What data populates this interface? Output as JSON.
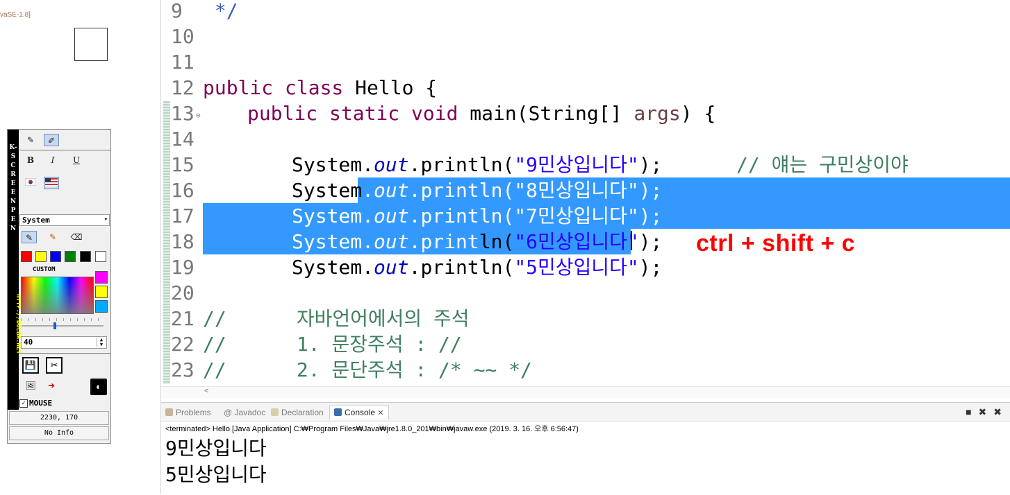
{
  "left_panel": {
    "jre_label": "vaSE-1.8]"
  },
  "kscreen_pen": {
    "vertical_title": "K-SCREEN PEN",
    "url": "HTTP://DOLBA.NET",
    "font_select": "System",
    "custom_label": "CUSTOM",
    "size_value": "40",
    "mouse_label": "MOUSE",
    "coords": "2230, 170",
    "info": "No Info",
    "palette": [
      "#ff0000",
      "#ffff00",
      "#0000ff",
      "#008000",
      "#000000",
      "#ffffff"
    ],
    "custom_swatches": [
      "#ff00ff",
      "#ffff00",
      "#00aaff"
    ]
  },
  "editor": {
    "lines": [
      {
        "no": "9",
        "text": " */"
      },
      {
        "no": "10",
        "text": ""
      },
      {
        "no": "11",
        "text": ""
      },
      {
        "no": "12",
        "kw": "public class",
        "rest": " Hello {"
      },
      {
        "no": "13",
        "kw": "public static void",
        "rest": " main(String[] ",
        "arg": "args",
        "tail": ") {"
      },
      {
        "no": "14",
        "text": ""
      },
      {
        "no": "15",
        "pre": "System.",
        "field": "out",
        "mid": ".println(",
        "str": "\"9민상입니다\"",
        "end": ");",
        "comment": "// 얘는 구민상이야"
      },
      {
        "no": "16",
        "pre": "System",
        "pre2": ".",
        "field": "out",
        "mid": ".println(",
        "str": "\"8민상입니다\"",
        "end": ");"
      },
      {
        "no": "17",
        "pre": "System.",
        "field": "out",
        "mid": ".println(",
        "str": "\"7민상입니다\"",
        "end": ");"
      },
      {
        "no": "18",
        "pre": "System.",
        "field": "out",
        "mid": ".println(",
        "str": "\"6민상입니다\"",
        "end": ");"
      },
      {
        "no": "19",
        "pre": "System.",
        "field": "out",
        "mid": ".println(",
        "str": "\"5민상입니다\"",
        "end": ");"
      },
      {
        "no": "20",
        "text": ""
      },
      {
        "no": "21",
        "text": "//      자바언어에서의 주석"
      },
      {
        "no": "22",
        "text": "//      1. 문장주석 : //"
      },
      {
        "no": "23",
        "text": "//      2. 문단주석 : /* ~~ */"
      }
    ],
    "annotation": "ctrl + shift + c"
  },
  "console": {
    "tabs": [
      {
        "label": "Problems",
        "icon": "problems-icon"
      },
      {
        "label": "@ Javadoc",
        "icon": "javadoc-icon"
      },
      {
        "label": "Declaration",
        "icon": "declaration-icon"
      },
      {
        "label": "Console",
        "icon": "console-icon",
        "active": true
      }
    ],
    "status": "<terminated> Hello [Java Application] C:₩Program Files₩Java₩jre1.8.0_201₩bin₩javaw.exe (2019. 3. 16. 오후 6:56:47)",
    "output": [
      "9민상입니다",
      "5민상입니다"
    ]
  }
}
